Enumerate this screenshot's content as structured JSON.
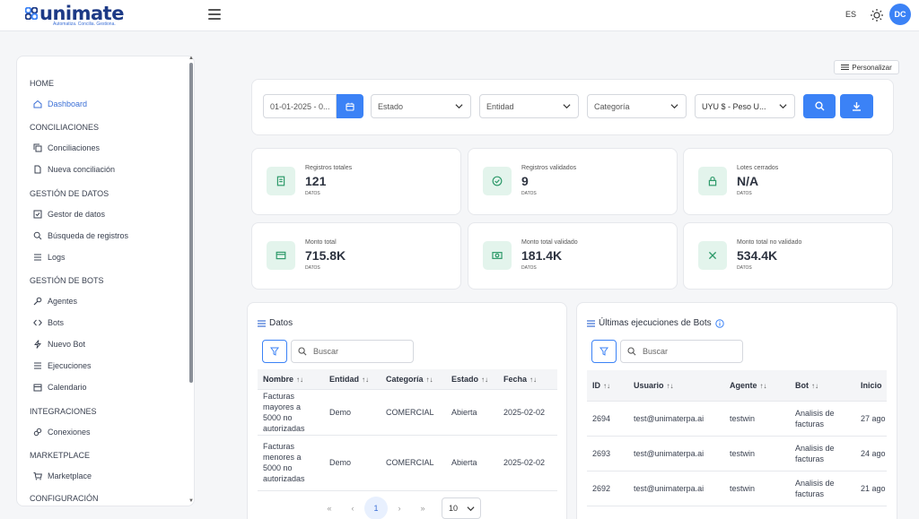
{
  "app": {
    "logo_text": "unimate",
    "logo_tagline": "Automatiza. Concilia. Gestiona.",
    "lang": "ES",
    "avatar_initials": "DC",
    "accent": "#3b82f6",
    "brand": "#1d3a86"
  },
  "sidebar": {
    "sections": [
      {
        "title": "HOME",
        "items": [
          {
            "label": "Dashboard",
            "icon": "home-icon",
            "active": true
          }
        ]
      },
      {
        "title": "CONCILIACIONES",
        "items": [
          {
            "label": "Conciliaciones",
            "icon": "copy-icon"
          },
          {
            "label": "Nueva conciliación",
            "icon": "file-icon"
          }
        ]
      },
      {
        "title": "GESTIÓN DE DATOS",
        "items": [
          {
            "label": "Gestor de datos",
            "icon": "checkbox-icon"
          },
          {
            "label": "Búsqueda de registros",
            "icon": "search-icon"
          },
          {
            "label": "Logs",
            "icon": "list-icon"
          }
        ]
      },
      {
        "title": "GESTIÓN DE BOTS",
        "items": [
          {
            "label": "Agentes",
            "icon": "wrench-icon"
          },
          {
            "label": "Bots",
            "icon": "code-icon"
          },
          {
            "label": "Nuevo Bot",
            "icon": "bolt-icon"
          },
          {
            "label": "Ejecuciones",
            "icon": "list-icon"
          },
          {
            "label": "Calendario",
            "icon": "calendar-icon"
          }
        ]
      },
      {
        "title": "INTEGRACIONES",
        "items": [
          {
            "label": "Conexiones",
            "icon": "link-icon"
          }
        ]
      },
      {
        "title": "MARKETPLACE",
        "items": [
          {
            "label": "Marketplace",
            "icon": "cart-icon"
          }
        ]
      },
      {
        "title": "CONFIGURACIÓN",
        "items": []
      }
    ]
  },
  "toolbar": {
    "personalizar": "Personalizar"
  },
  "filters": {
    "date_range": "01-01-2025 - 0...",
    "estado": "Estado",
    "entidad": "Entidad",
    "categoria": "Categoría",
    "currency": "UYU $ - Peso U..."
  },
  "stats": [
    {
      "label": "Registros totales",
      "value": "121",
      "unit": "DATOS",
      "icon": "document-icon"
    },
    {
      "label": "Registros validados",
      "value": "9",
      "unit": "DATOS",
      "icon": "check-circle-icon"
    },
    {
      "label": "Lotes cerrados",
      "value": "N/A",
      "unit": "DATOS",
      "icon": "lock-icon"
    },
    {
      "label": "Monto total",
      "value": "715.8K",
      "unit": "DATOS",
      "icon": "credit-card-icon"
    },
    {
      "label": "Monto total validado",
      "value": "181.4K",
      "unit": "DATOS",
      "icon": "money-icon"
    },
    {
      "label": "Monto total no validado",
      "value": "534.4K",
      "unit": "DATOS",
      "icon": "x-icon"
    }
  ],
  "datos": {
    "title": "Datos",
    "search_placeholder": "Buscar",
    "columns": [
      "Nombre",
      "Entidad",
      "Categoría",
      "Estado",
      "Fecha"
    ],
    "rows": [
      [
        "Facturas mayores a 5000 no autorizadas",
        "Demo",
        "COMERCIAL",
        "Abierta",
        "2025-02-02"
      ],
      [
        "Facturas menores a 5000 no autorizadas",
        "Demo",
        "COMERCIAL",
        "Abierta",
        "2025-02-02"
      ]
    ],
    "pagination": {
      "current": "1",
      "rows_per_page": "10"
    }
  },
  "bots": {
    "title": "Últimas ejecuciones de Bots",
    "search_placeholder": "Buscar",
    "columns": [
      "ID",
      "Usuario",
      "Agente",
      "Bot",
      "Inicio"
    ],
    "rows": [
      [
        "2694",
        "test@unimaterpa.ai",
        "testwin",
        "Analisis de facturas",
        "27 ago"
      ],
      [
        "2693",
        "test@unimaterpa.ai",
        "testwin",
        "Analisis de facturas",
        "24 ago"
      ],
      [
        "2692",
        "test@unimaterpa.ai",
        "testwin",
        "Analisis de facturas",
        "21 ago"
      ],
      [
        "",
        "",
        "",
        "Analisis de",
        ""
      ]
    ]
  }
}
